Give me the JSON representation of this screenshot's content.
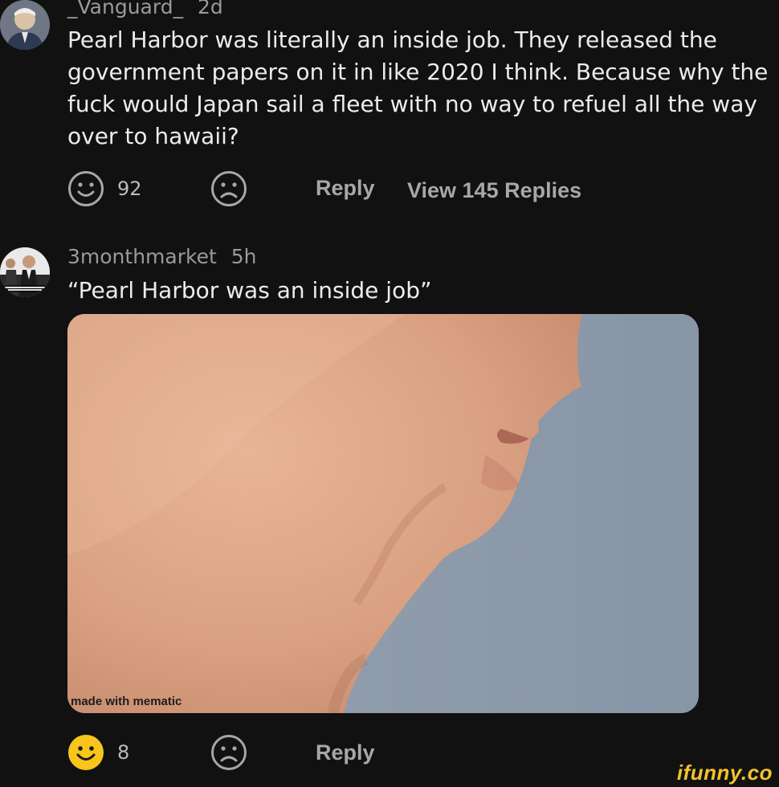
{
  "comments": [
    {
      "username": "_Vanguard_",
      "time": "2d",
      "text": "Pearl Harbor was literally an inside job. They released the government papers on it in like 2020 I think. Because why the fuck would Japan sail a fleet with no way to refuel all the way over to hawaii?",
      "smile_count": "92",
      "reply_label": "Reply",
      "view_replies_label": "View 145 Replies"
    },
    {
      "username": "3monthmarket",
      "time": "5h",
      "text": "“Pearl Harbor was an inside job”",
      "image_watermark": "made with mematic",
      "smile_count": "8",
      "reply_label": "Reply"
    }
  ],
  "icons": {
    "smile": "smile-icon",
    "frown": "frown-icon"
  },
  "colors": {
    "background": "#111112",
    "active_smile": "#f7c51c",
    "muted": "#a7a7a7"
  },
  "branding": {
    "site_logo": "ifunny.co"
  }
}
